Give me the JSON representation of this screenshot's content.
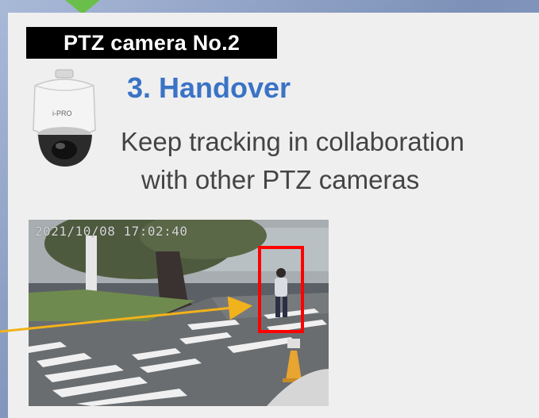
{
  "camera_label": "PTZ camera No.2",
  "camera_brand": "i-PRO",
  "heading": "3. Handover",
  "description_line1": "Keep tracking in collaboration",
  "description_line2": "with other PTZ cameras",
  "video_timestamp": "2021/10/08 17:02:40",
  "colors": {
    "heading": "#3a73c6",
    "label_background": "#000000",
    "tracking_box": "#ff0000",
    "pointer_arrow": "#f2b21b",
    "top_arrow": "#6abf4b"
  }
}
